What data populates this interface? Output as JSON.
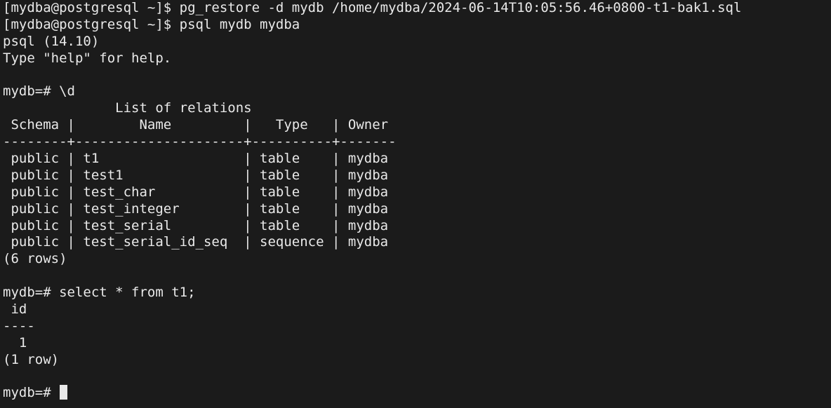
{
  "terminal": {
    "lines": [
      "[mydba@postgresql ~]$ pg_restore -d mydb /home/mydba/2024-06-14T10:05:56.46+0800-t1-bak1.sql",
      "[mydba@postgresql ~]$ psql mydb mydba",
      "psql (14.10)",
      "Type \"help\" for help.",
      "",
      "mydb=# \\d",
      "              List of relations",
      " Schema |        Name         |   Type   | Owner",
      "--------+---------------------+----------+-------",
      " public | t1                  | table    | mydba",
      " public | test1               | table    | mydba",
      " public | test_char           | table    | mydba",
      " public | test_integer        | table    | mydba",
      " public | test_serial         | table    | mydba",
      " public | test_serial_id_seq  | sequence | mydba",
      "(6 rows)",
      "",
      "mydb=# select * from t1;",
      " id",
      "----",
      "  1",
      "(1 row)",
      ""
    ],
    "prompt": "mydb=# "
  }
}
